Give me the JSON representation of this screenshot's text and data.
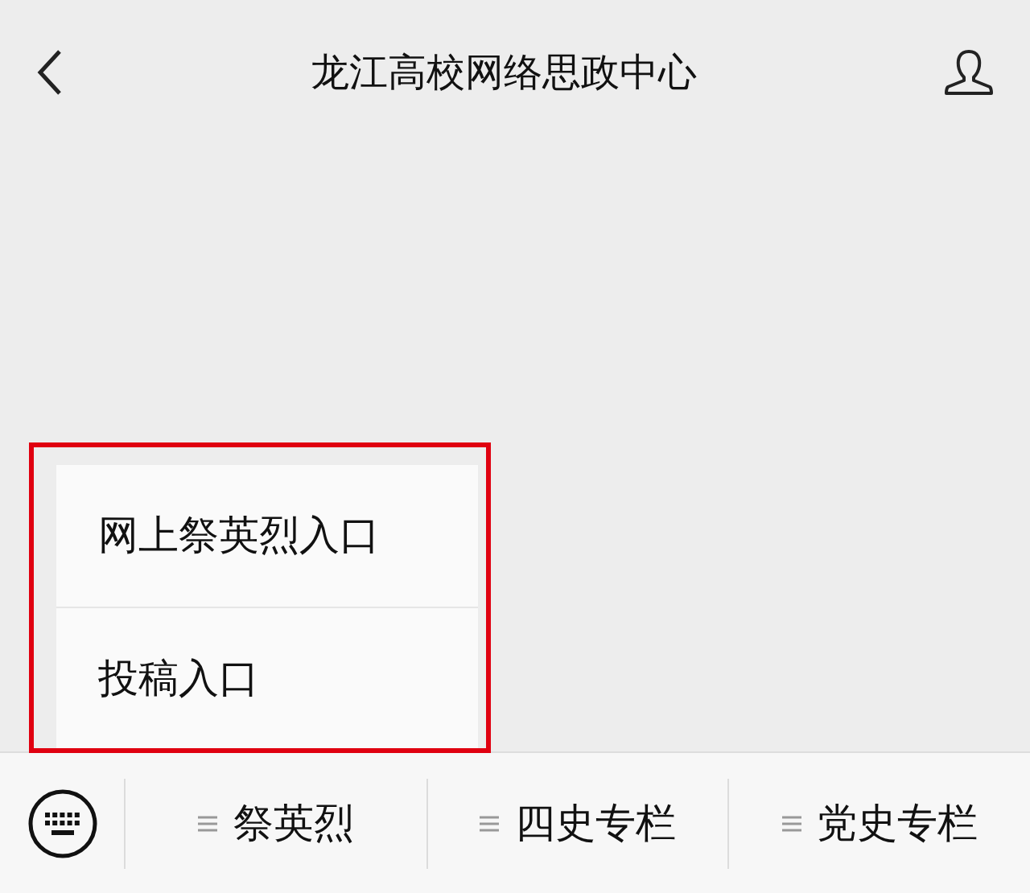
{
  "header": {
    "title": "龙江高校网络思政中心"
  },
  "popup_menu": {
    "items": [
      "网上祭英烈入口",
      "投稿入口"
    ]
  },
  "menu_bar": {
    "items": [
      "祭英烈",
      "四史专栏",
      "党史专栏"
    ]
  }
}
